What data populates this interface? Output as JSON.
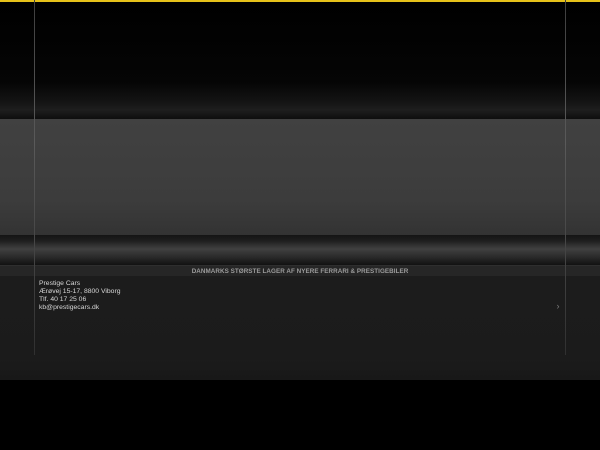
{
  "header": {
    "accent_color": "#e6c21a"
  },
  "tagline": "DANMARKS STØRSTE LAGER AF NYERE FERRARI & PRESTIGEBILER",
  "contact": {
    "company": "Prestige Cars",
    "address": "Ærøvej 15-17, 8800 Viborg",
    "phone": "Tlf. 40 17 25 06",
    "email": "kb@prestigecars.dk"
  },
  "navigation": {
    "next_arrow": "›",
    "next_icon": "chevron-right-icon"
  }
}
